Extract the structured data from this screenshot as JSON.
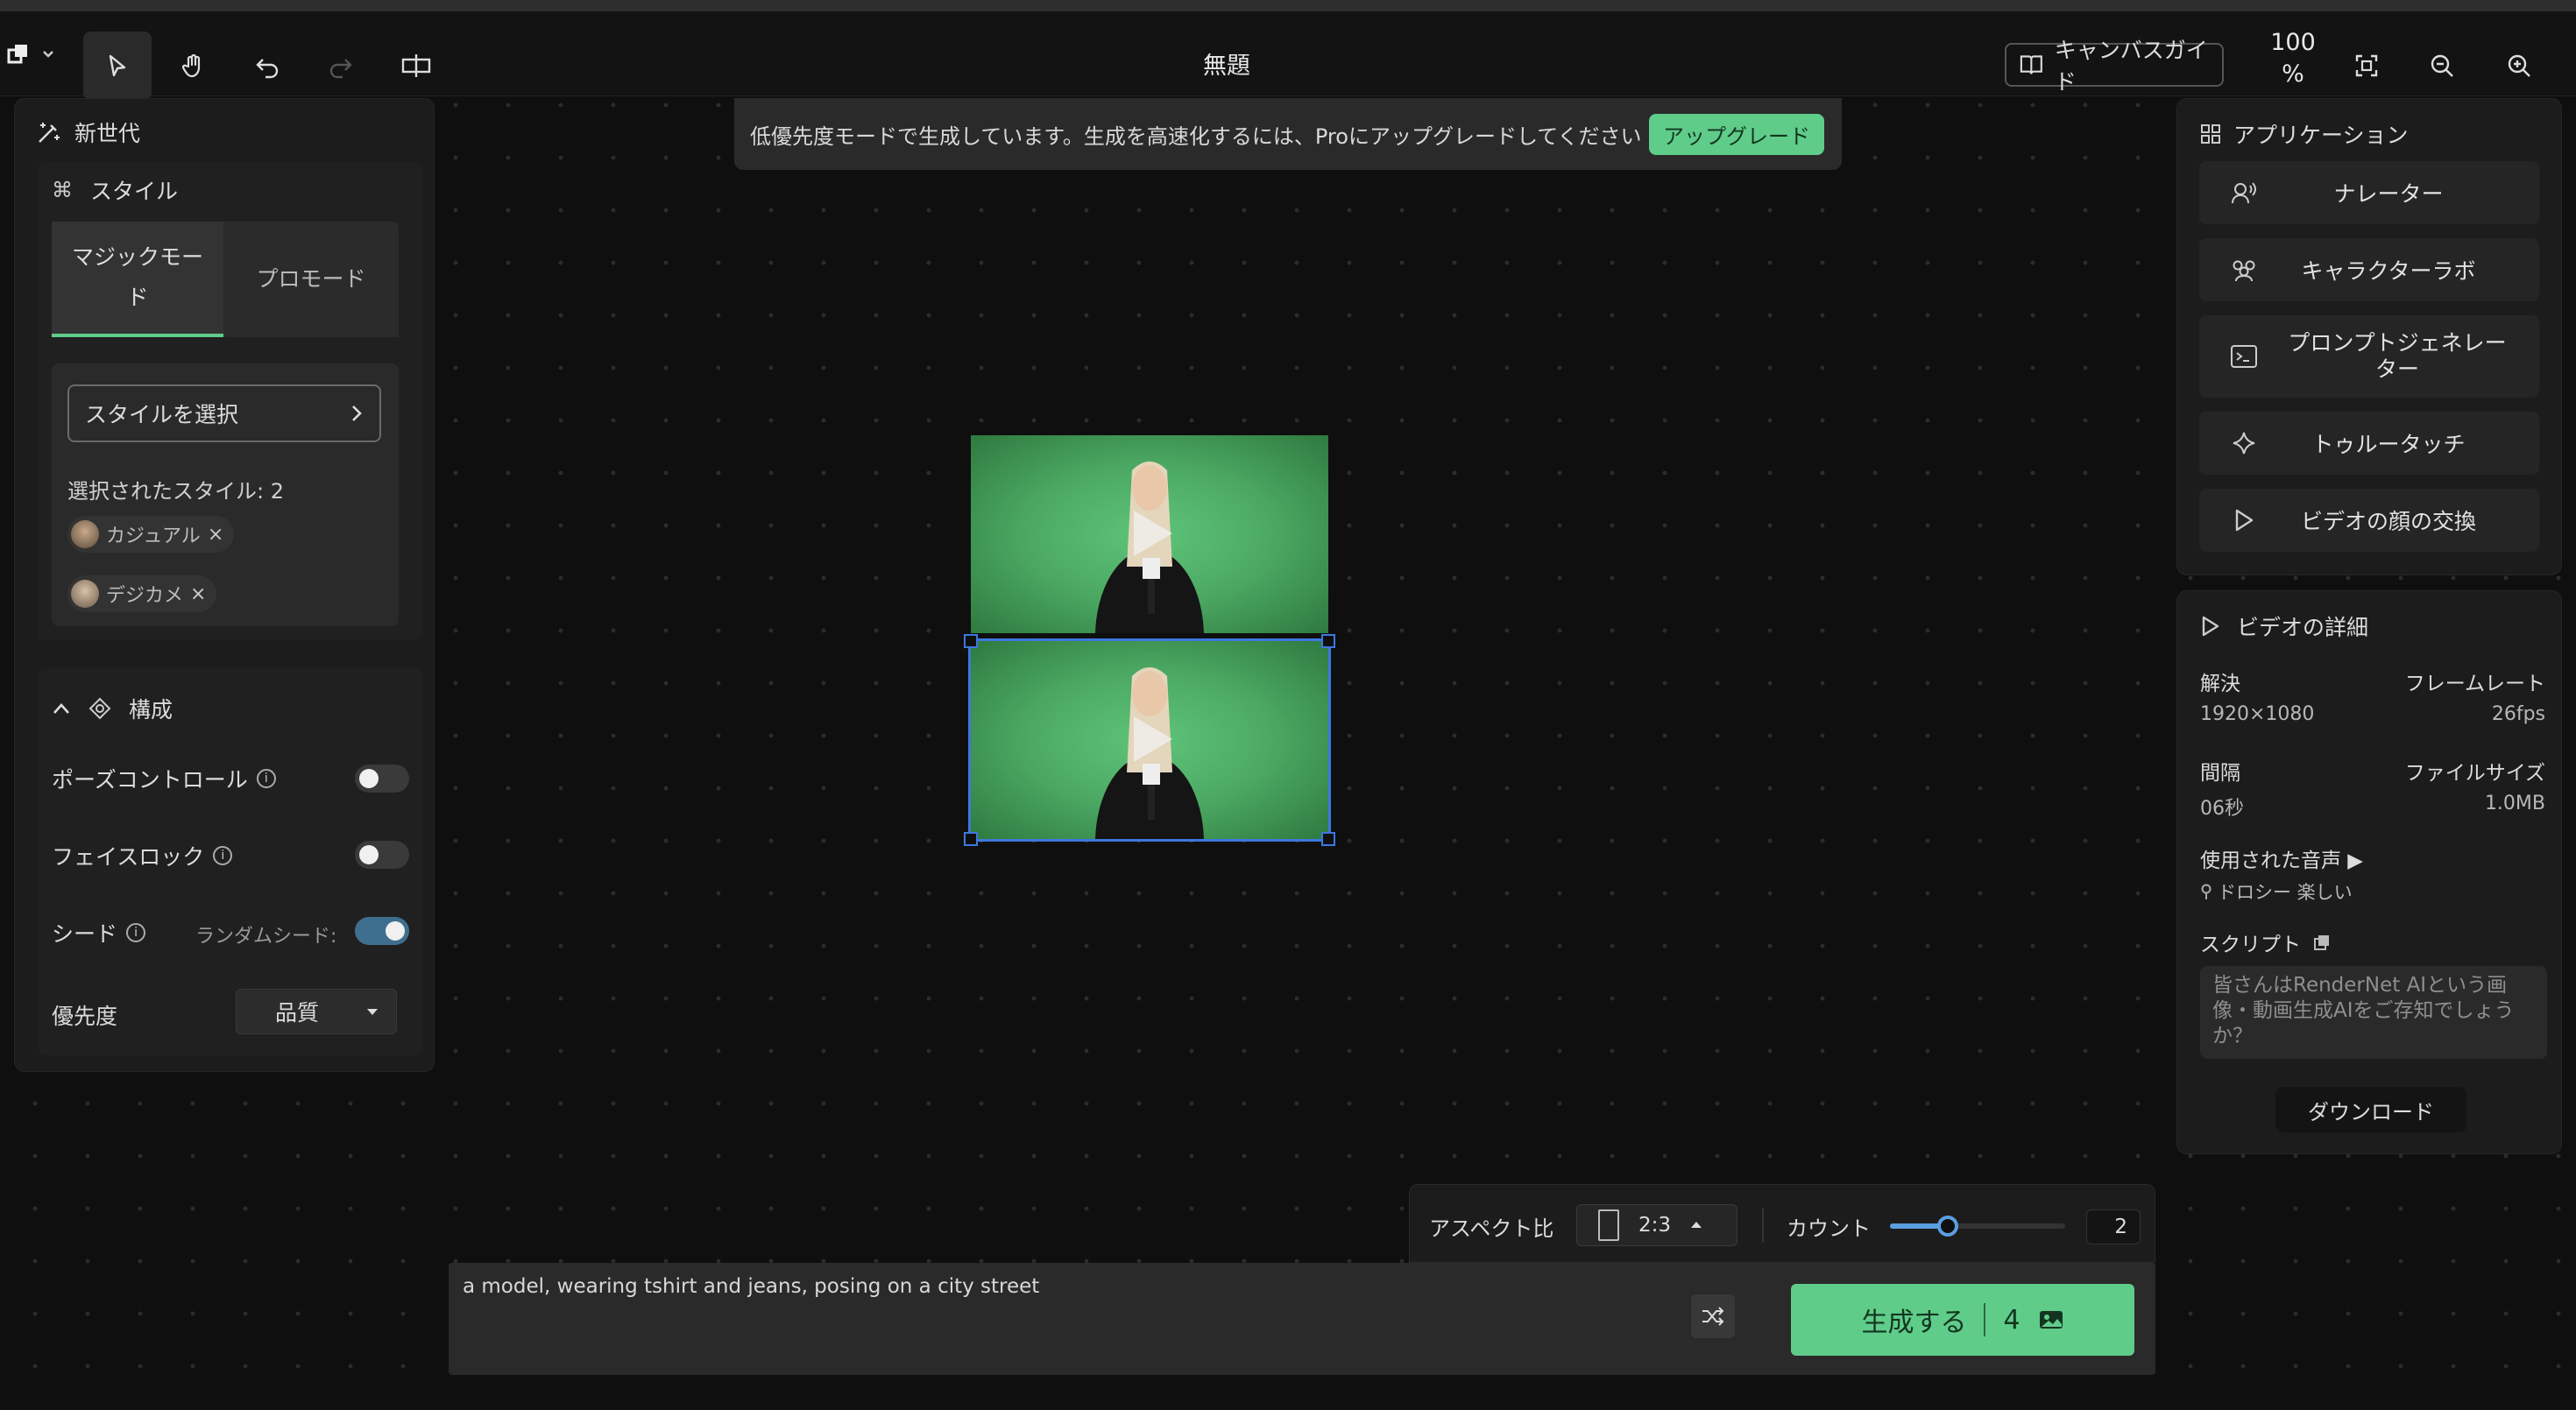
{
  "topbar": {
    "title": "無題",
    "guide_label": "キャンバスガイド",
    "zoom_line1": "100",
    "zoom_line2": "%"
  },
  "notice": {
    "text": "低優先度モードで生成しています。生成を高速化するには、Proにアップグレードしてください",
    "upgrade_label": "アップグレード"
  },
  "left_panel": {
    "header": "新世代",
    "style_section": "スタイル",
    "tabs": [
      "マジックモード",
      "プロモード"
    ],
    "select_style": "スタイルを選択",
    "selected_count": "選択されたスタイル: 2",
    "chips": [
      "カジュアル",
      "デジカメ"
    ],
    "composition": "構成",
    "pose_control": "ポーズコントロール",
    "face_lock": "フェイスロック",
    "seed": "シード",
    "random_seed": "ランダムシード:",
    "priority": "優先度",
    "priority_value": "品質"
  },
  "right_panel": {
    "apps_header": "アプリケーション",
    "apps": [
      "ナレーター",
      "キャラクターラボ",
      "プロンプトジェネレーター",
      "トゥルータッチ",
      "ビデオの顔の交換"
    ],
    "details_header": "ビデオの詳細",
    "resolution_label": "解決",
    "resolution_value": "1920×1080",
    "framerate_label": "フレームレート",
    "framerate_value": "26fps",
    "duration_label": "間隔",
    "duration_value": "06秒",
    "filesize_label": "ファイルサイズ",
    "filesize_value": "1.0MB",
    "voice_label": "使用された音声 ▶",
    "voice_value": "ドロシー 楽しい",
    "script_label": "スクリプト",
    "script_text": "皆さんはRenderNet AIという画像・動画生成AIをご存知でしょうか？",
    "download_label": "ダウンロード"
  },
  "bottom": {
    "aspect_label": "アスペクト比",
    "aspect_value": "2:3",
    "count_label": "カウント",
    "count_value": "2",
    "count_fraction": 0.33,
    "prompt": "a model, wearing tshirt and jeans, posing on a city street",
    "generate_label": "生成する",
    "generate_count": "4"
  },
  "colors": {
    "accent_green": "#5fcc8a",
    "selection_blue": "#3d78e0",
    "bg": "#0f0f0f"
  }
}
